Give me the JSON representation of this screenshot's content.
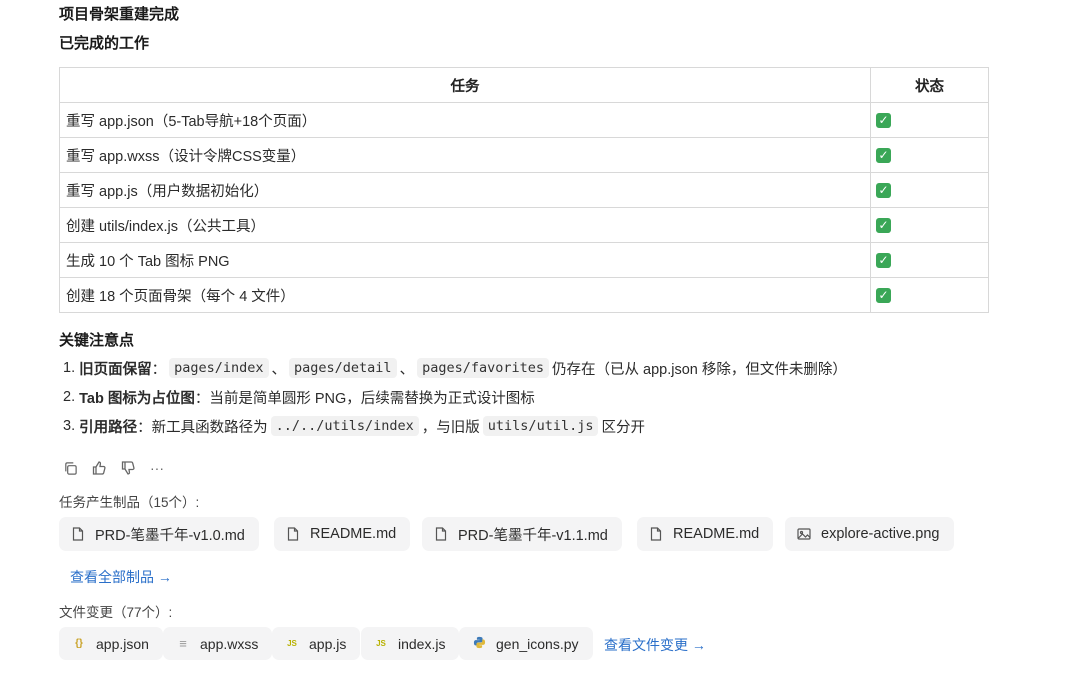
{
  "header": {
    "title": "项目骨架重建完成",
    "subtitle": "已完成的工作"
  },
  "table": {
    "headers": {
      "task": "任务",
      "status": "状态"
    },
    "rows": [
      {
        "task": "重写 app.json（5-Tab导航+18个页面）",
        "status": "✓"
      },
      {
        "task": "重写 app.wxss（设计令牌CSS变量）",
        "status": "✓"
      },
      {
        "task": "重写 app.js（用户数据初始化）",
        "status": "✓"
      },
      {
        "task": "创建 utils/index.js（公共工具）",
        "status": "✓"
      },
      {
        "task": "生成 10 个 Tab 图标 PNG",
        "status": "✓"
      },
      {
        "task": "创建 18 个页面骨架（每个 4 文件）",
        "status": "✓"
      }
    ]
  },
  "notes": {
    "title": "关键注意点",
    "n1": {
      "num": "1.",
      "bold": "旧页面保留",
      "colon": "：",
      "code1": "pages/index",
      "sep1": "、",
      "code2": "pages/detail",
      "sep2": "、",
      "code3": "pages/favorites",
      "rest": "仍存在（已从 app.json 移除，但文件未删除）"
    },
    "n2": {
      "num": "2.",
      "bold": "Tab 图标为占位图",
      "rest": "：当前是简单圆形 PNG，后续需替换为正式设计图标"
    },
    "n3": {
      "num": "3.",
      "bold": "引用路径",
      "rest1": "：新工具函数路径为",
      "code1": "../../utils/index",
      "rest2": "，与旧版",
      "code2": "utils/util.js",
      "rest3": "区分开"
    }
  },
  "actions": {
    "more": "···"
  },
  "artifacts": {
    "label": "任务产生制品（15个）:",
    "items": [
      "PRD-笔墨千年-v1.0.md",
      "README.md",
      "PRD-笔墨千年-v1.1.md",
      "README.md",
      "explore-active.png"
    ],
    "view_all": "查看全部制品 →"
  },
  "file_changes": {
    "label": "文件变更（77个）:",
    "items": [
      {
        "name": "app.json",
        "icon": "{}",
        "icon_color": "#c9a227"
      },
      {
        "name": "app.wxss",
        "icon": "≡",
        "icon_color": "#9a9a9a"
      },
      {
        "name": "app.js",
        "icon": "JS",
        "icon_color": "#b8b100"
      },
      {
        "name": "index.js",
        "icon": "JS",
        "icon_color": "#b8b100"
      },
      {
        "name": "gen_icons.py",
        "icon": "py",
        "icon_color": "#3d7ab8"
      }
    ],
    "view_changes": "查看文件变更 →"
  },
  "colors": {
    "link": "#2a6fc9",
    "check": "#3aa757",
    "chip_bg": "#f4f4f5"
  }
}
